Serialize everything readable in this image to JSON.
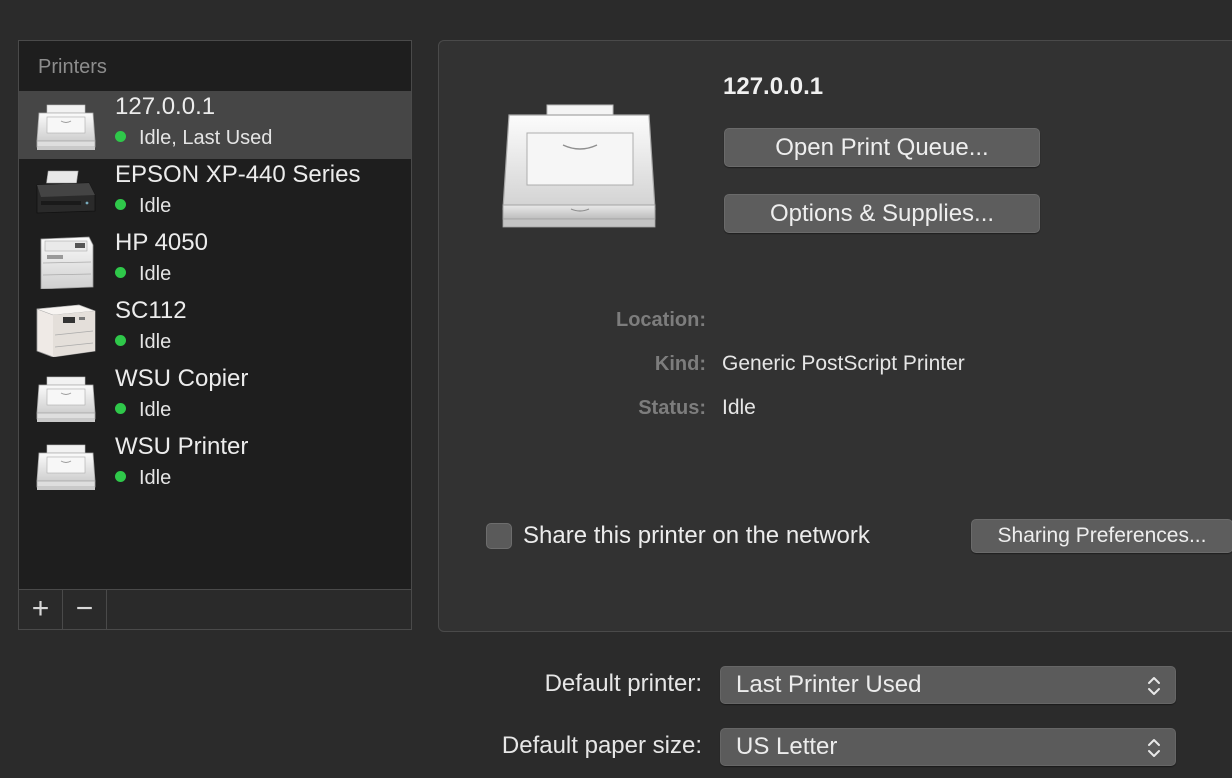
{
  "list": {
    "header": "Printers",
    "items": [
      {
        "name": "127.0.0.1",
        "status": "Idle, Last Used",
        "icon": "generic-printer-icon",
        "selected": true
      },
      {
        "name": "EPSON XP-440 Series",
        "status": "Idle",
        "icon": "inkjet-printer-icon",
        "selected": false
      },
      {
        "name": "HP 4050",
        "status": "Idle",
        "icon": "laser-printer-icon",
        "selected": false
      },
      {
        "name": "SC112",
        "status": "Idle",
        "icon": "office-printer-icon",
        "selected": false
      },
      {
        "name": "WSU Copier",
        "status": "Idle",
        "icon": "generic-printer-icon",
        "selected": false
      },
      {
        "name": "WSU Printer",
        "status": "Idle",
        "icon": "generic-printer-icon",
        "selected": false
      }
    ],
    "add_label": "+",
    "remove_label": "−"
  },
  "detail": {
    "title": "127.0.0.1",
    "open_queue_label": "Open Print Queue...",
    "options_label": "Options & Supplies...",
    "location_label": "Location:",
    "location_value": "",
    "kind_label": "Kind:",
    "kind_value": "Generic PostScript Printer",
    "status_label": "Status:",
    "status_value": "Idle",
    "share_label": "Share this printer on the network",
    "share_checked": false,
    "sharing_prefs_label": "Sharing Preferences..."
  },
  "defaults": {
    "printer_label": "Default printer:",
    "printer_value": "Last Printer Used",
    "paper_label": "Default paper size:",
    "paper_value": "US Letter"
  },
  "colors": {
    "background": "#2b2b2b",
    "status_dot": "#2fc84a",
    "selection": "#464646"
  }
}
